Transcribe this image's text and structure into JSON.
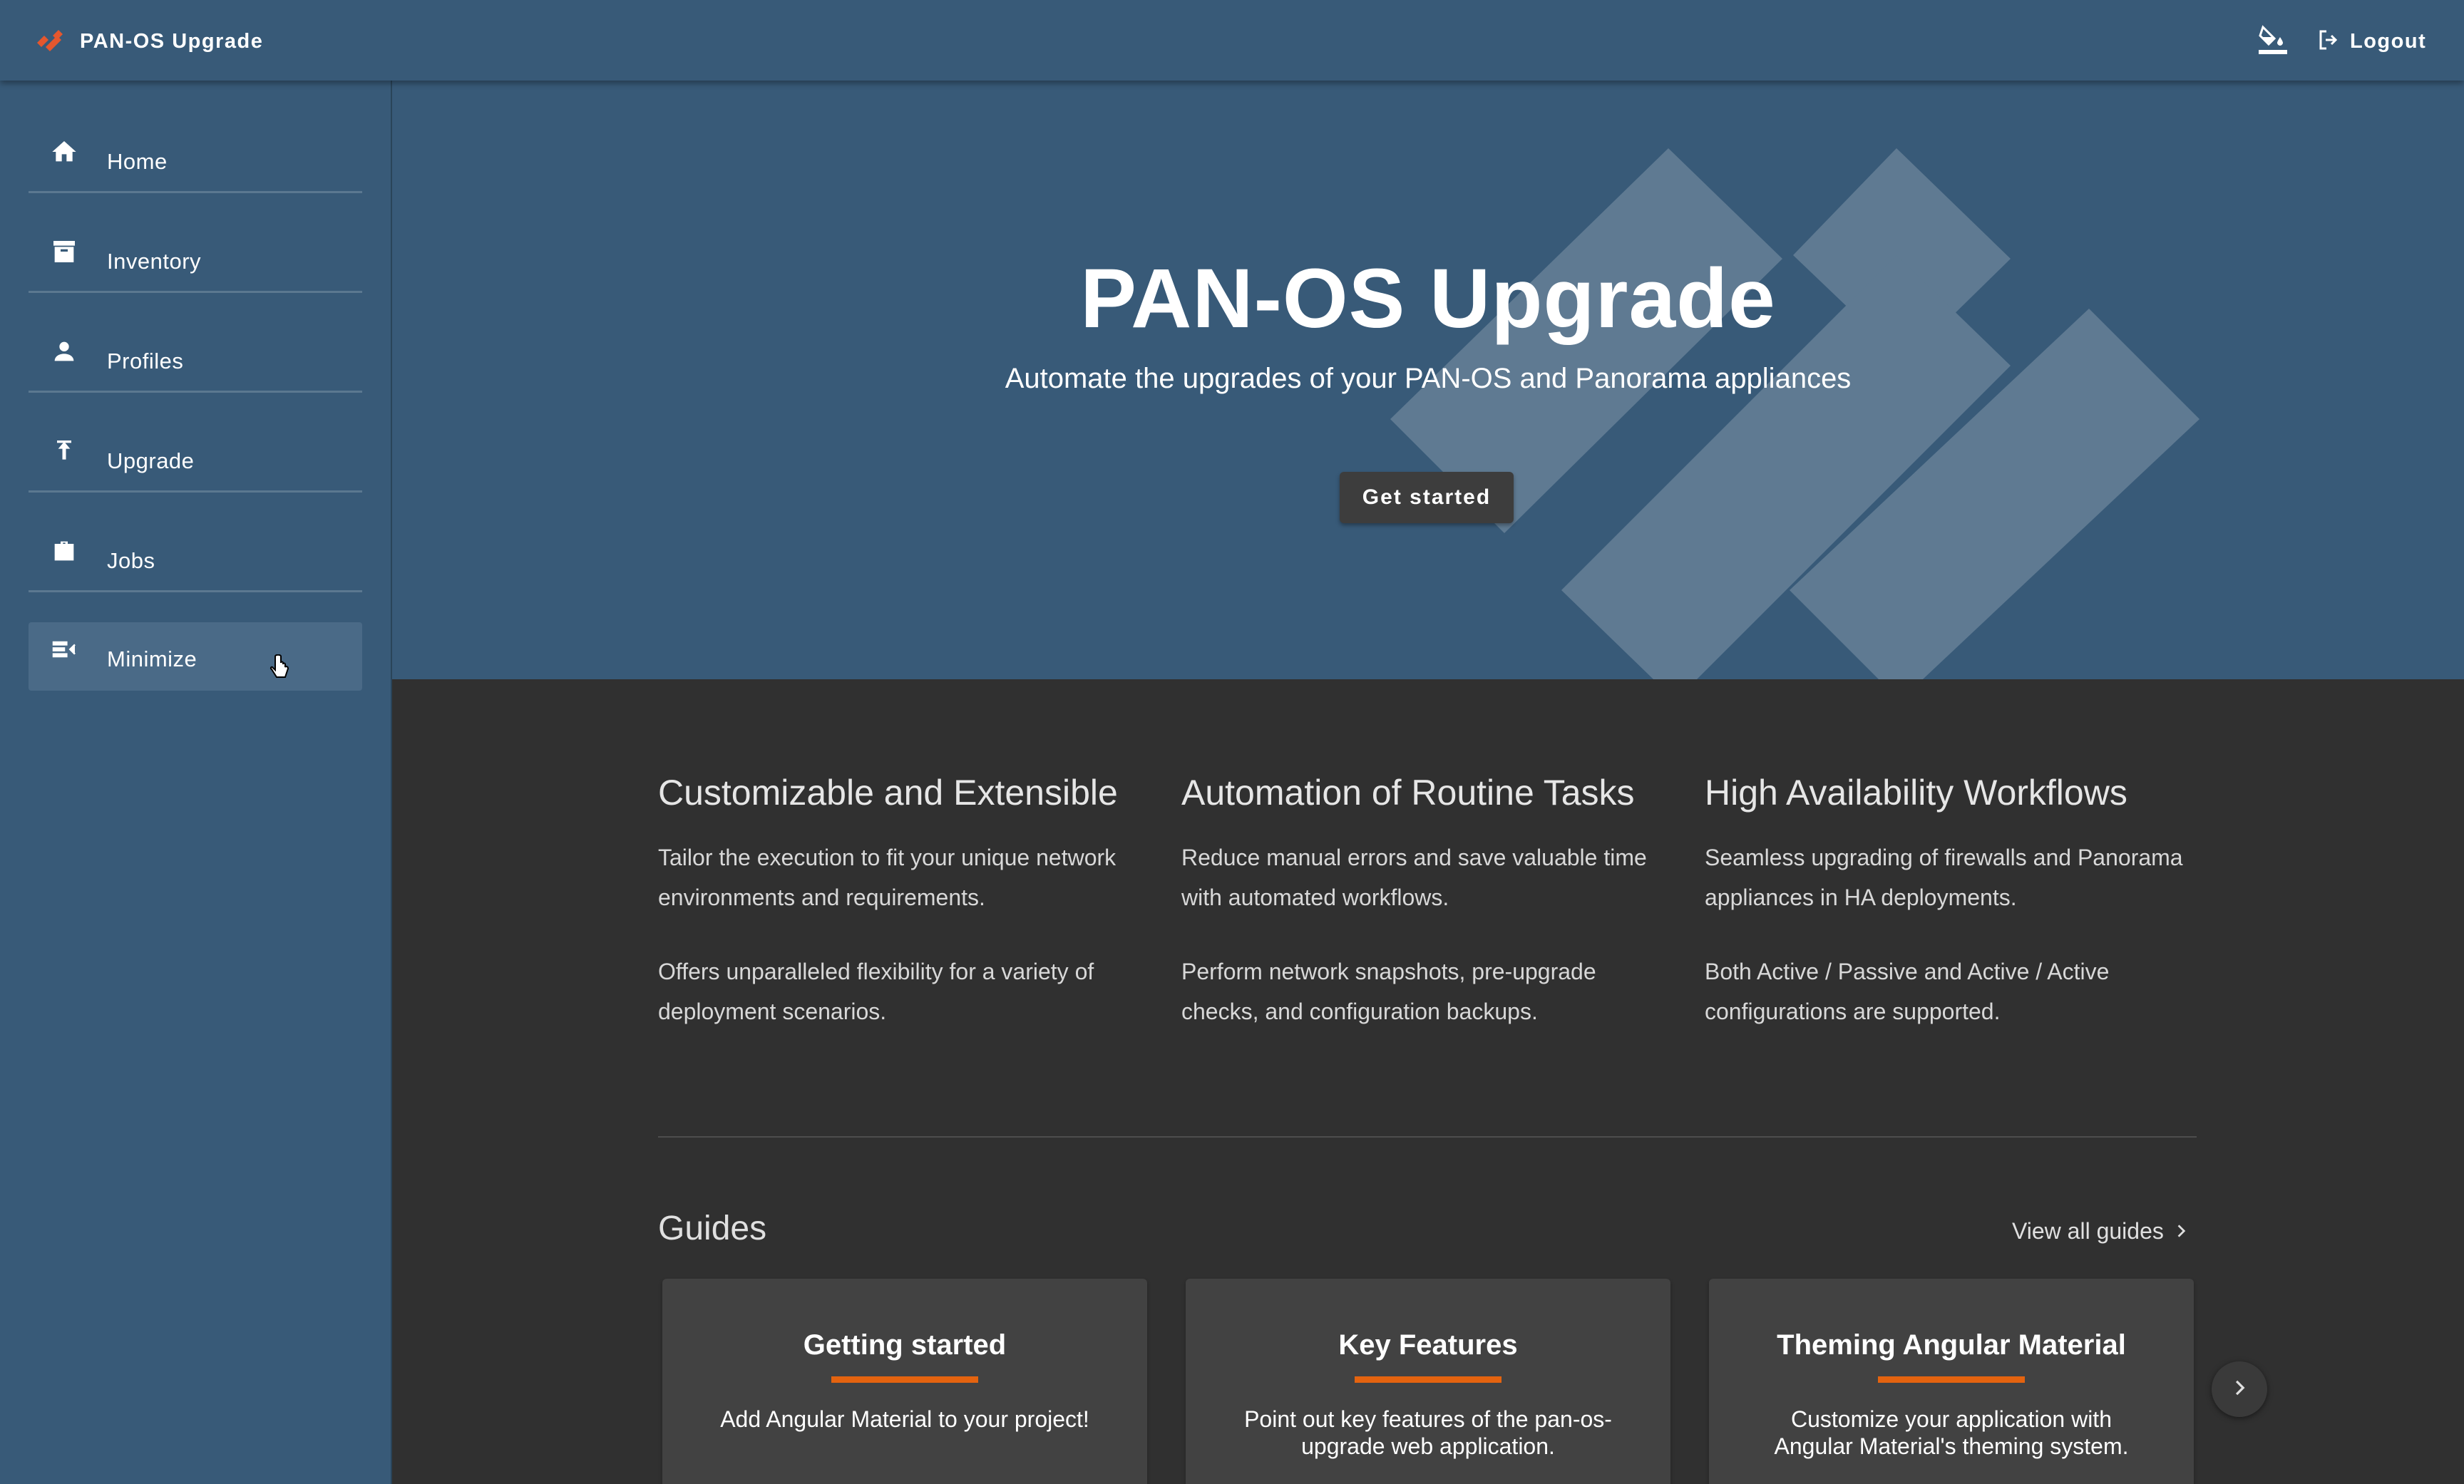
{
  "app": {
    "title": "PAN-OS Upgrade",
    "logout_label": "Logout"
  },
  "sidebar": {
    "items": [
      {
        "label": "Home",
        "icon": "home-icon"
      },
      {
        "label": "Inventory",
        "icon": "archive-icon"
      },
      {
        "label": "Profiles",
        "icon": "person-icon"
      },
      {
        "label": "Upgrade",
        "icon": "upload-icon"
      },
      {
        "label": "Jobs",
        "icon": "briefcase-icon"
      },
      {
        "label": "Minimize",
        "icon": "menu-collapse-icon"
      }
    ]
  },
  "hero": {
    "title": "PAN-OS Upgrade",
    "subtitle": "Automate the upgrades of your PAN-OS and Panorama appliances",
    "cta_label": "Get started"
  },
  "features": [
    {
      "title": "Customizable and Extensible",
      "p1": "Tailor the execution to fit your unique network environments and requirements.",
      "p2": "Offers unparalleled flexibility for a variety of deployment scenarios."
    },
    {
      "title": "Automation of Routine Tasks",
      "p1": "Reduce manual errors and save valuable time with automated workflows.",
      "p2": "Perform network snapshots, pre-upgrade checks, and configuration backups."
    },
    {
      "title": "High Availability Workflows",
      "p1": "Seamless upgrading of firewalls and Panorama appliances in HA deployments.",
      "p2": "Both Active / Passive and Active / Active configurations are supported."
    }
  ],
  "guides": {
    "title": "Guides",
    "view_all_label": "View all guides",
    "cards": [
      {
        "title": "Getting started",
        "description": "Add Angular Material to your project!"
      },
      {
        "title": "Key Features",
        "description": "Point out key features of the pan-os-upgrade web application."
      },
      {
        "title": "Theming Angular Material",
        "description": "Customize your application with Angular Material's theming system."
      }
    ]
  },
  "colors": {
    "primary": "#385a78",
    "background": "#303030",
    "card": "#424242",
    "accent": "#e4630f",
    "brand_logo": "#e4572e"
  }
}
